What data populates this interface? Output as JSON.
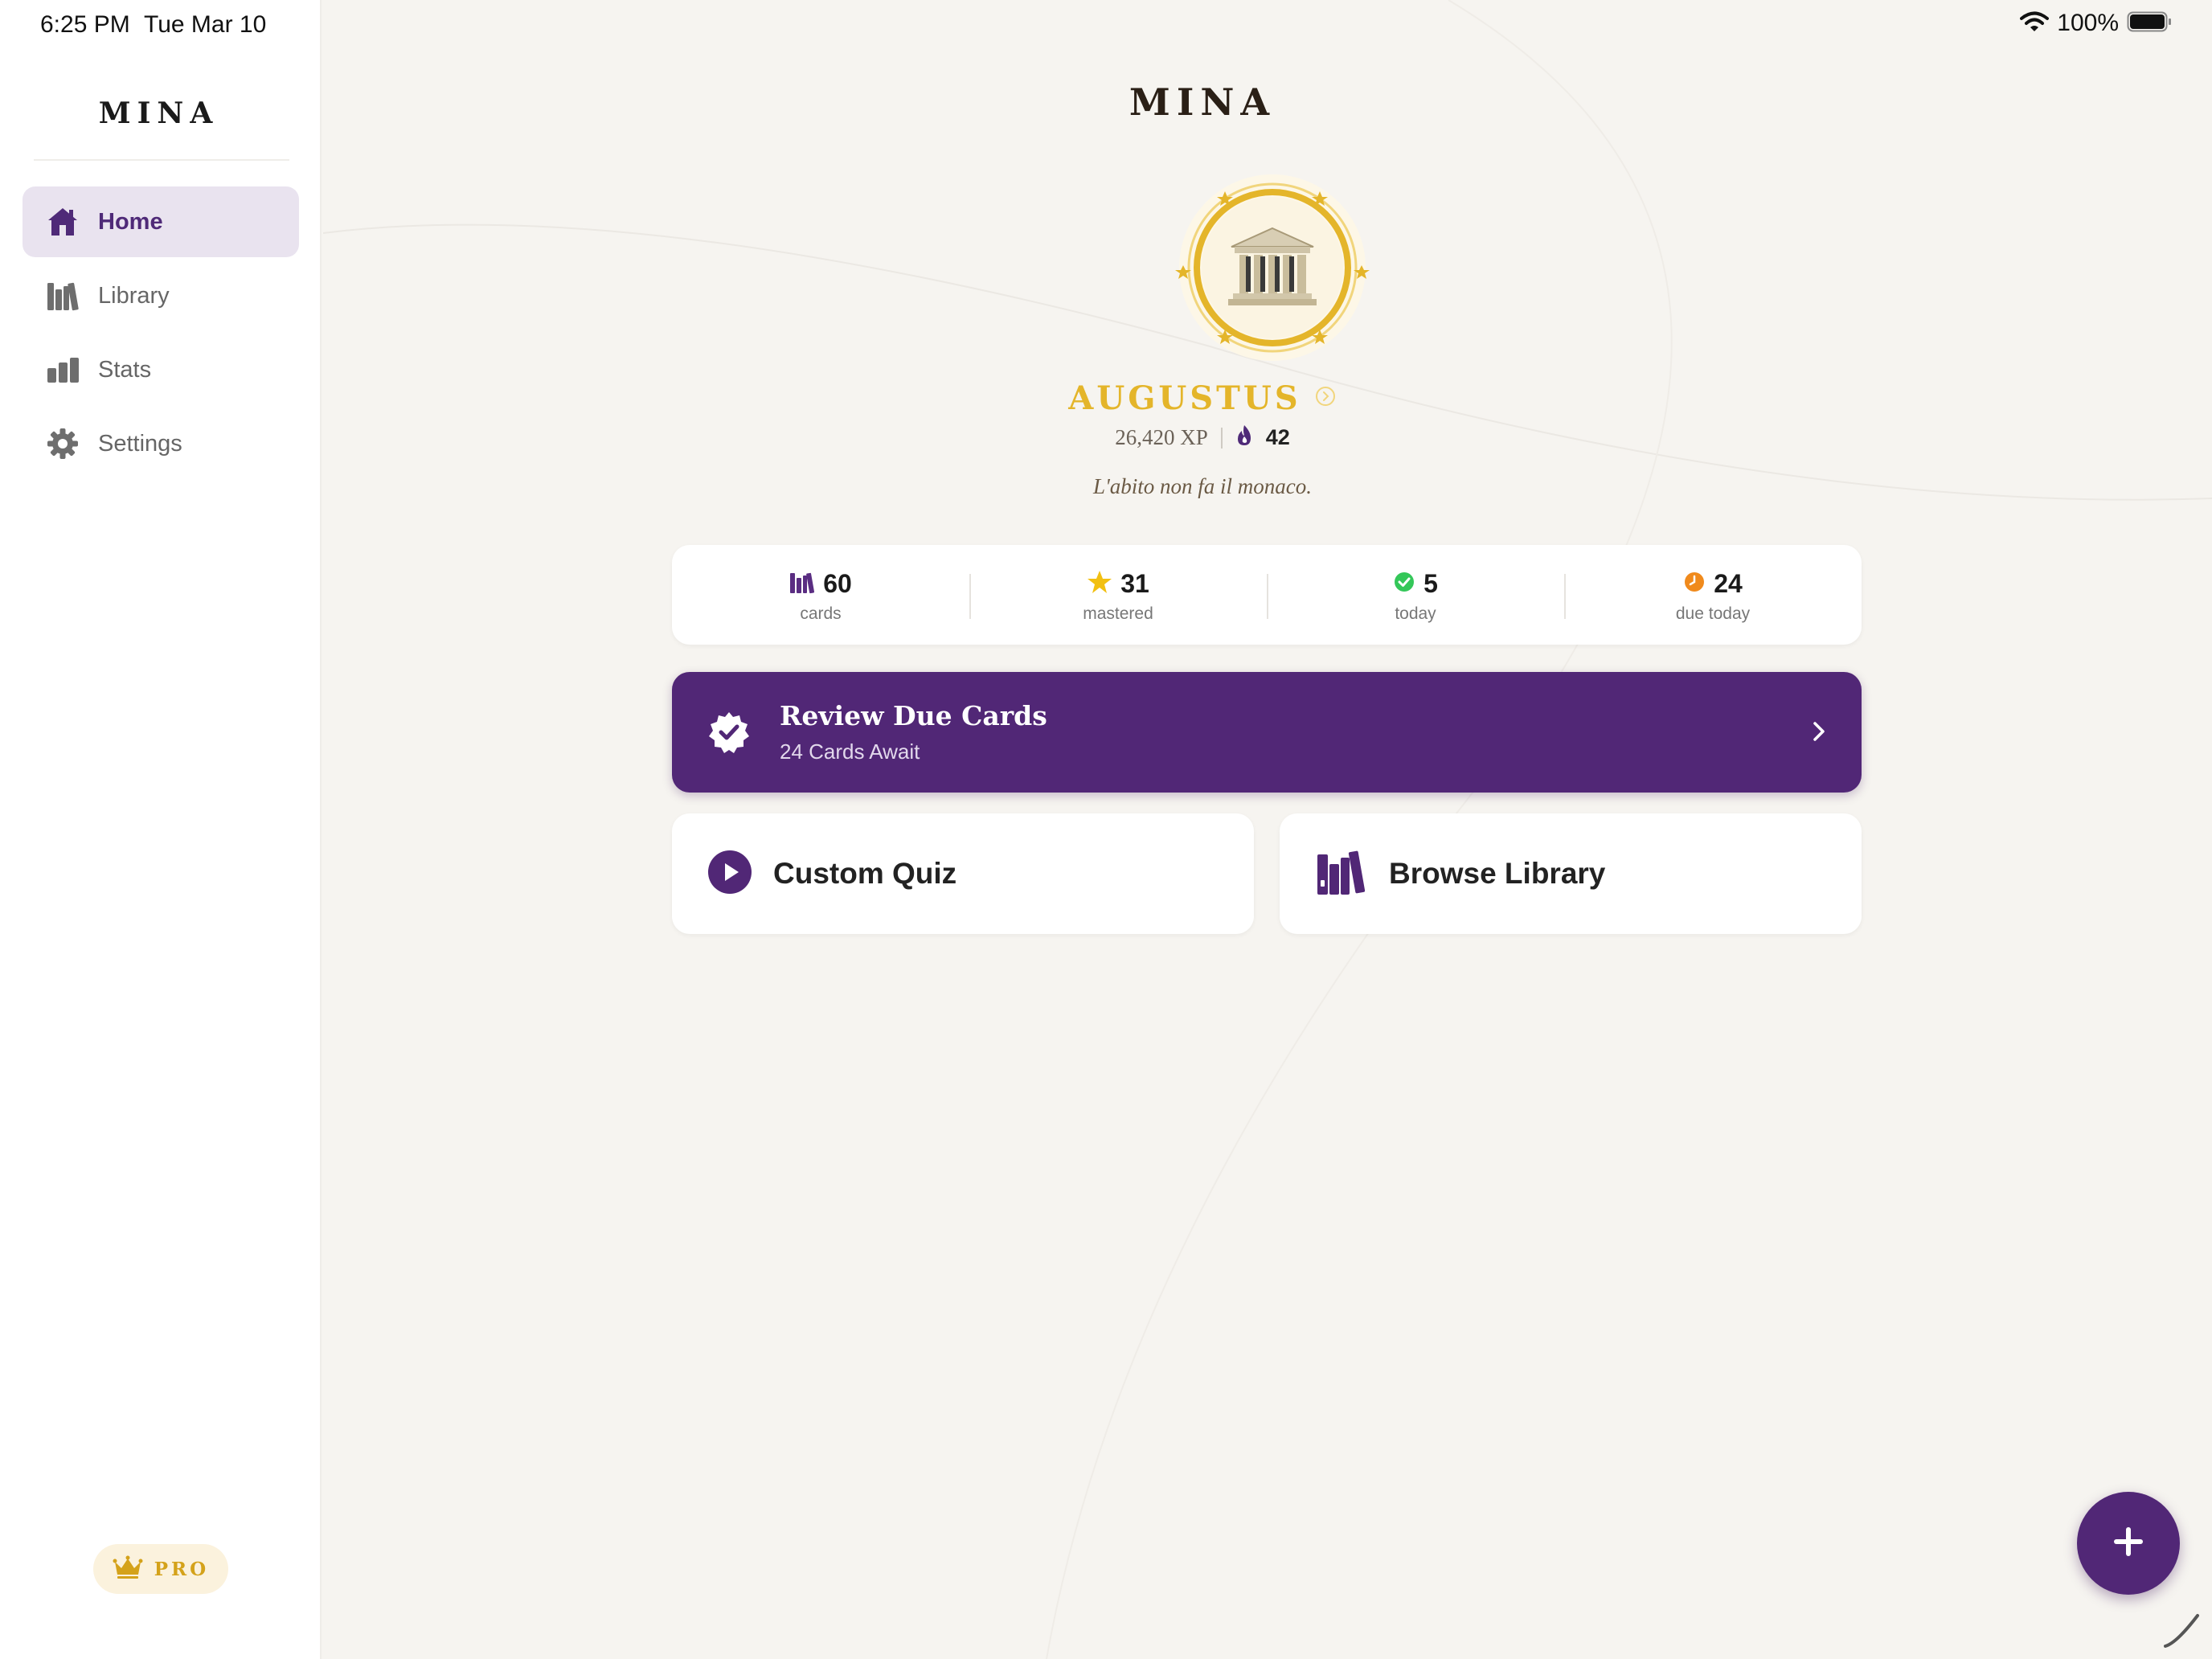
{
  "status_bar": {
    "time": "6:25 PM",
    "date": "Tue Mar 10",
    "battery": "100%",
    "icons": [
      "wifi-icon",
      "battery-icon"
    ]
  },
  "sidebar": {
    "brand": "MINA",
    "items": [
      {
        "label": "Home",
        "icon": "house-icon",
        "active": true
      },
      {
        "label": "Library",
        "icon": "books-icon",
        "active": false
      },
      {
        "label": "Stats",
        "icon": "bar-chart-icon",
        "active": false
      },
      {
        "label": "Settings",
        "icon": "gear-icon",
        "active": false
      }
    ],
    "pro_badge": {
      "label": "PRO",
      "icon": "crown-icon"
    }
  },
  "main": {
    "title": "MINA",
    "rank": {
      "name": "AUGUSTUS",
      "emblem_icon": "temple-icon",
      "info_icon": "chevron-circle-icon"
    },
    "xp": "26,420 XP",
    "streak": {
      "icon": "flame-icon",
      "value": "42"
    },
    "motto": "L'abito non fa il monaco.",
    "stats": [
      {
        "value": "60",
        "label": "cards",
        "icon": "books-icon",
        "color": "#5a2d82"
      },
      {
        "value": "31",
        "label": "mastered",
        "icon": "star-icon",
        "color": "#f2c012"
      },
      {
        "value": "5",
        "label": "today",
        "icon": "check-circle-icon",
        "color": "#34c759"
      },
      {
        "value": "24",
        "label": "due today",
        "icon": "clock-icon",
        "color": "#f08a1c"
      }
    ],
    "review": {
      "title": "Review Due Cards",
      "subtitle": "24 Cards Await",
      "icon": "verified-badge-icon",
      "chevron_icon": "chevron-right-icon"
    },
    "actions": [
      {
        "label": "Custom Quiz",
        "icon": "play-circle-icon"
      },
      {
        "label": "Browse Library",
        "icon": "books-icon"
      }
    ],
    "fab": {
      "icon": "plus-icon"
    }
  },
  "colors": {
    "accent": "#512776",
    "gold": "#e4b52a",
    "background": "#f6f4f0",
    "nav_active_bg": "#e9e3ef"
  }
}
